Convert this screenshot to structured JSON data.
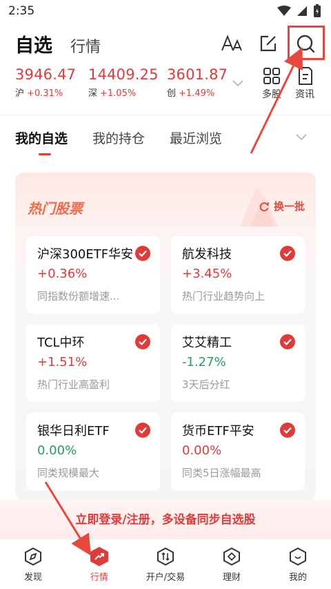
{
  "status": {
    "time": "2:35"
  },
  "header": {
    "title": "自选",
    "subtitle": "行情"
  },
  "indices": [
    {
      "value": "3946.47",
      "market": "沪",
      "change": "+0.31%"
    },
    {
      "value": "14409.25",
      "market": "深",
      "change": "+1.05%"
    },
    {
      "value": "3601.87",
      "market": "创",
      "change": "+1.49%"
    }
  ],
  "tools": {
    "multi_label": "多股",
    "news_label": "资讯"
  },
  "tabs": [
    "我的自选",
    "我的持仓",
    "最近浏览"
  ],
  "hot": {
    "title": "热门股票",
    "refresh_label": "换一批",
    "stocks": [
      {
        "name": "沪深300ETF华安",
        "change": "+0.36%",
        "desc": "同指数份额增速...",
        "trend": "up"
      },
      {
        "name": "航发科技",
        "change": "+3.45%",
        "desc": "热门行业趋势向上",
        "trend": "up"
      },
      {
        "name": "TCL中环",
        "change": "+1.51%",
        "desc": "热门行业高盈利",
        "trend": "up"
      },
      {
        "name": "艾艾精工",
        "change": "-1.27%",
        "desc": "3天后分红",
        "trend": "down"
      },
      {
        "name": "银华日利ETF",
        "change": "0.00%",
        "desc": "同类规模最大",
        "trend": "down"
      },
      {
        "name": "货币ETF平安",
        "change": "0.00%",
        "desc": "同类5日涨幅最高",
        "trend": "up"
      }
    ]
  },
  "login_banner": "立即登录/注册，多设备同步自选股",
  "nav": [
    "发现",
    "行情",
    "开户/交易",
    "理财",
    "我的"
  ],
  "colors": {
    "accent": "#e03a3a",
    "up": "#e03a3a",
    "down": "#22a05a",
    "annotation": "#e8473c"
  }
}
